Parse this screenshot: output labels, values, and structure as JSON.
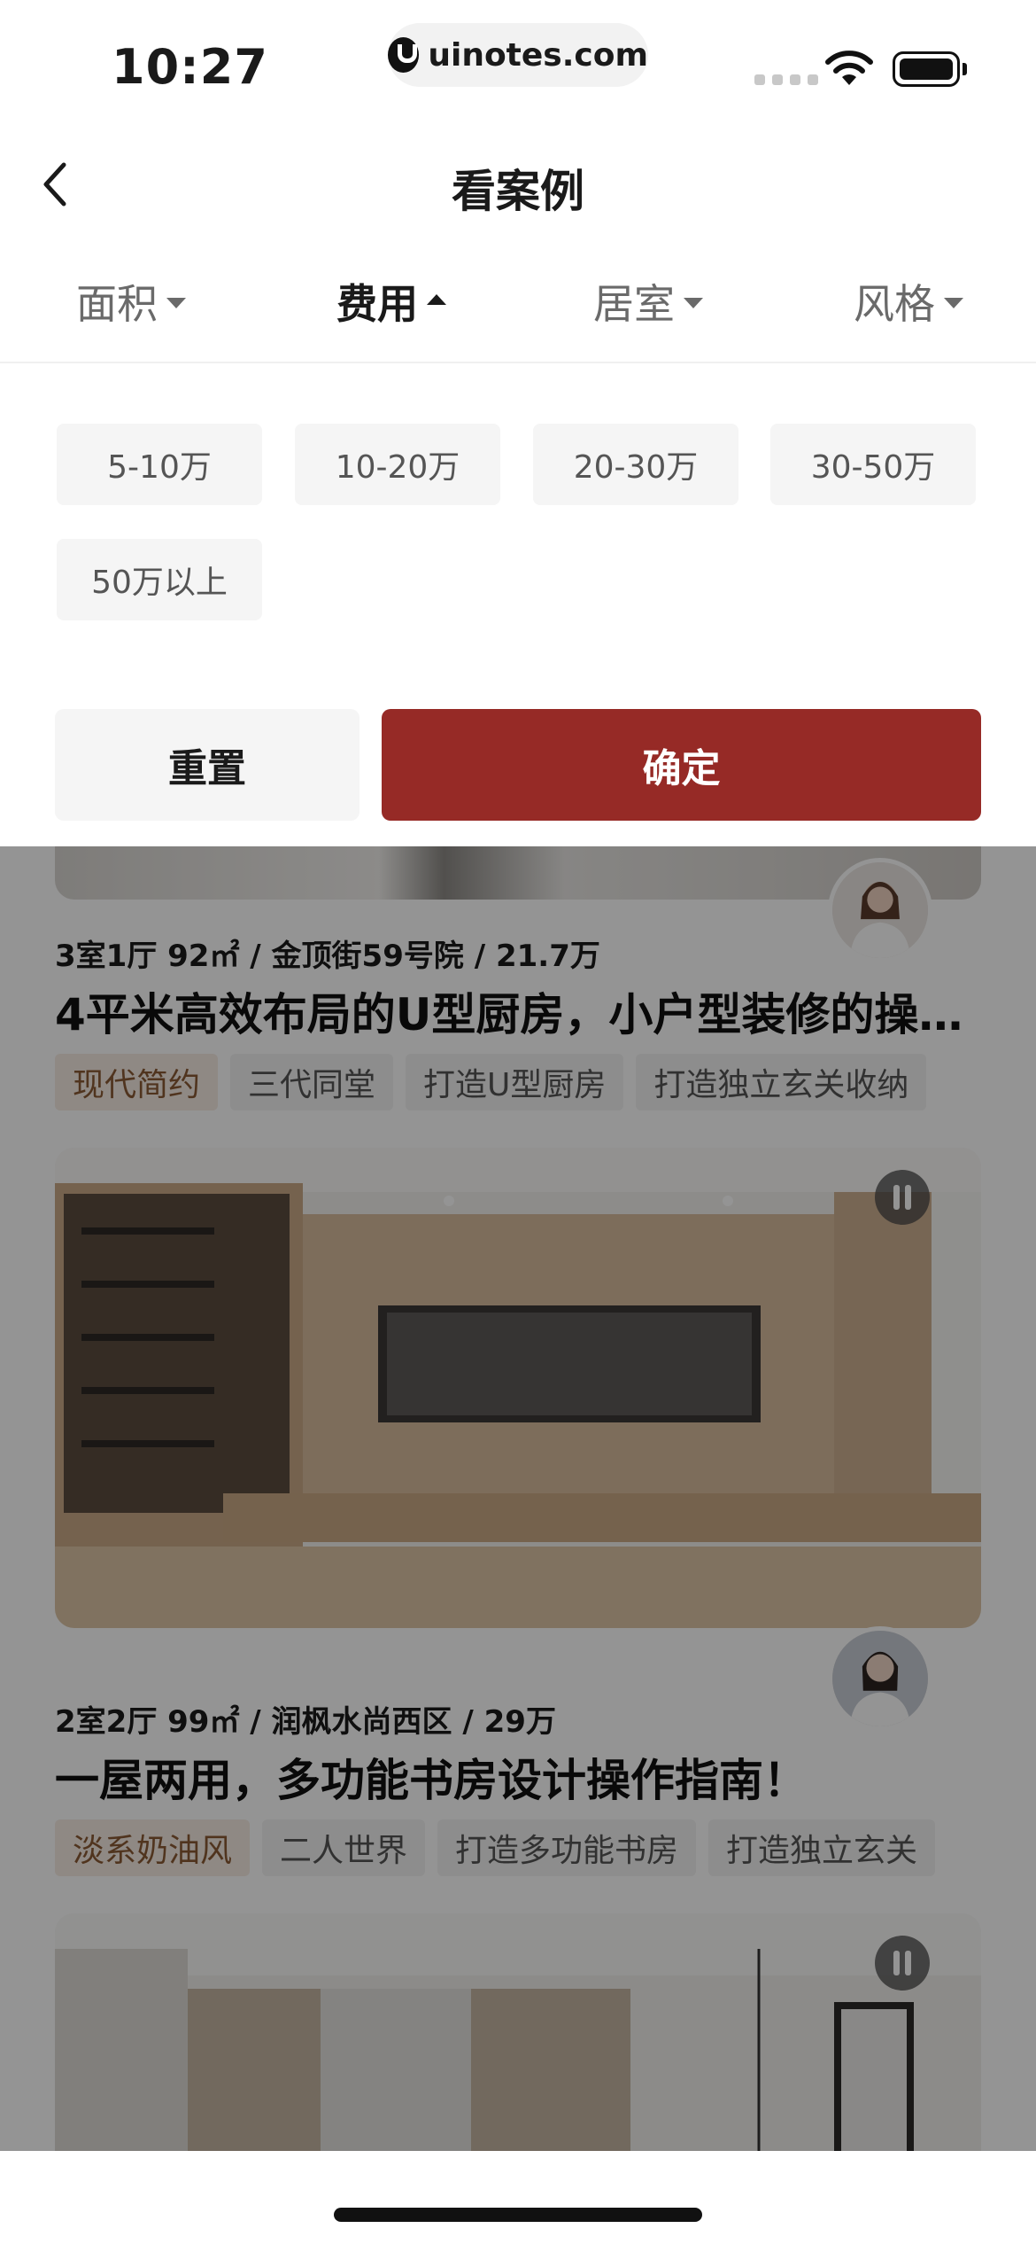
{
  "status_bar": {
    "time": "10:27",
    "url": "uinotes.com"
  },
  "nav": {
    "title": "看案例"
  },
  "filters": {
    "tabs": [
      {
        "label": "面积",
        "state": "collapsed"
      },
      {
        "label": "费用",
        "state": "expanded"
      },
      {
        "label": "居室",
        "state": "collapsed"
      },
      {
        "label": "风格",
        "state": "collapsed"
      }
    ],
    "options": [
      "5-10万",
      "10-20万",
      "20-30万",
      "30-50万",
      "50万以上"
    ],
    "reset_label": "重置",
    "confirm_label": "确定"
  },
  "cases": [
    {
      "meta": "3室1厅 92㎡ / 金顶街59号院 / 21.7万",
      "title": "4平米高效布局的U型厨房，小户型装修的操…",
      "tags": [
        "现代简约",
        "三代同堂",
        "打造U型厨房",
        "打造独立玄关收纳"
      ]
    },
    {
      "meta": "2室2厅 99㎡ / 润枫水尚西区 / 29万",
      "title": "一屋两用，多功能书房设计操作指南！",
      "tags": [
        "淡系奶油风",
        "二人世界",
        "打造多功能书房",
        "打造独立玄关"
      ]
    }
  ],
  "colors": {
    "accent": "#962a26",
    "overlay": "rgba(0,0,0,0.42)"
  }
}
